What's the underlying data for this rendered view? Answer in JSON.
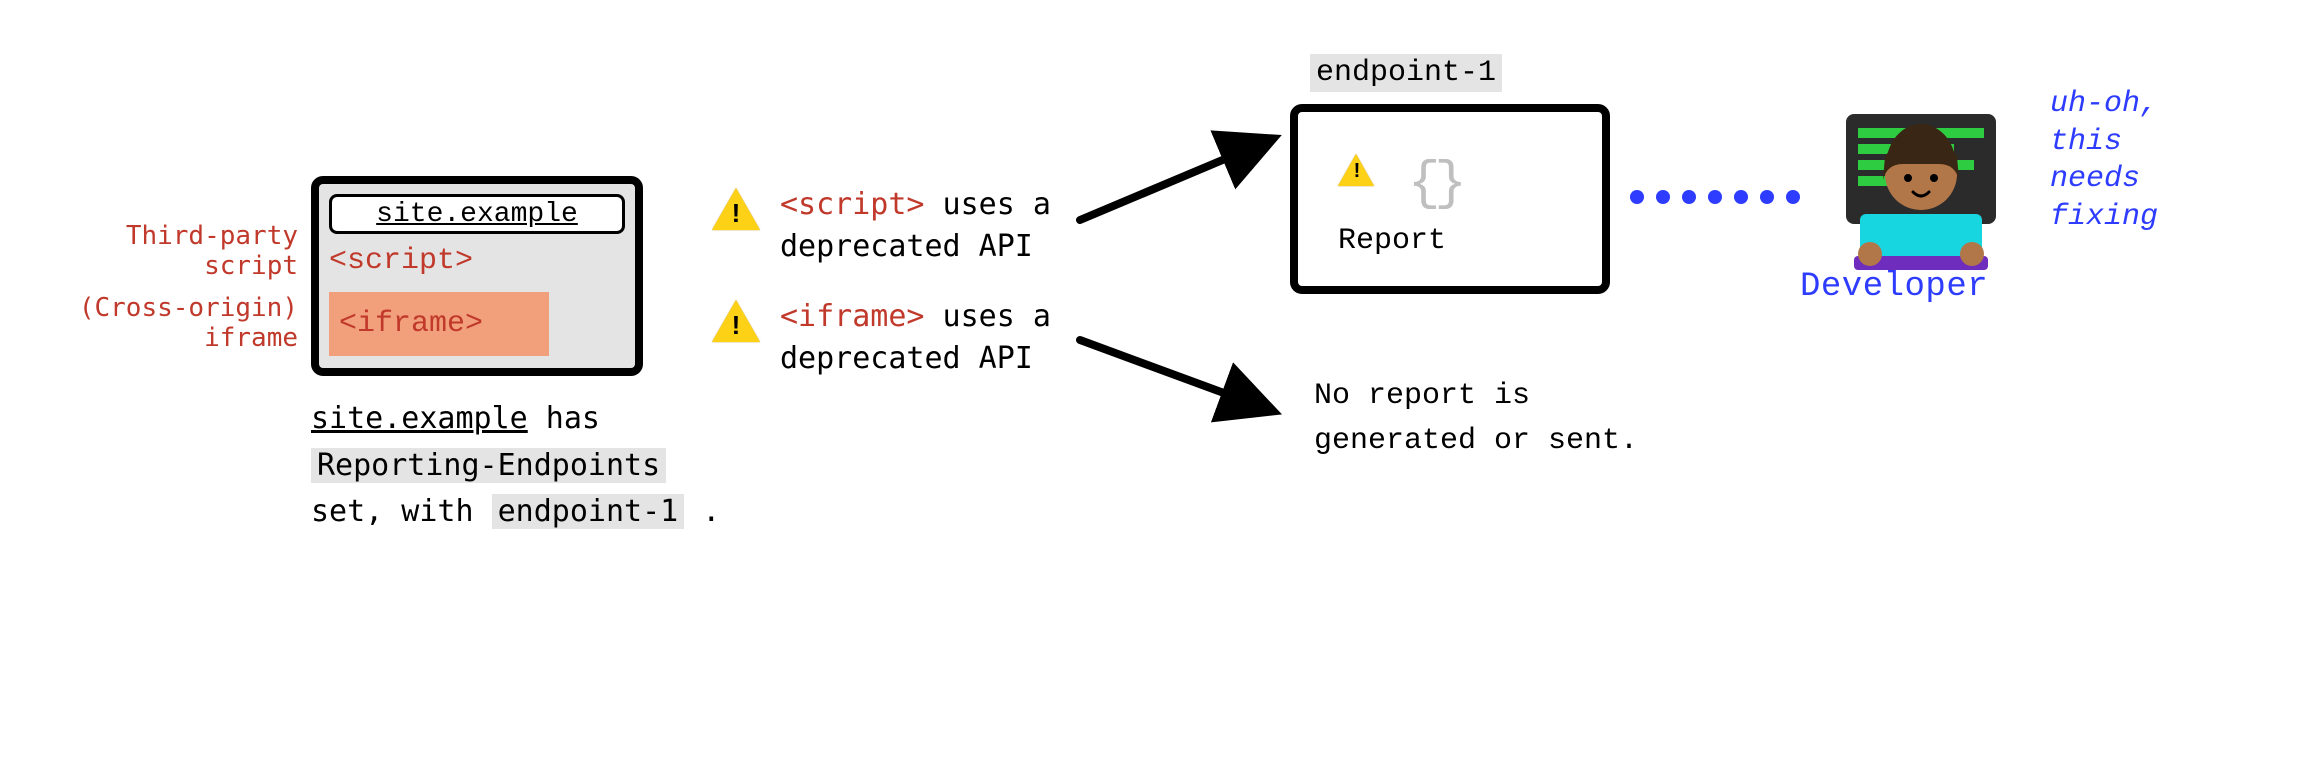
{
  "left_labels": {
    "third_party_script_l1": "Third-party",
    "third_party_script_l2": "script",
    "cross_origin_iframe_l1": "(Cross-origin)",
    "cross_origin_iframe_l2": "iframe"
  },
  "browser": {
    "url": "site.example",
    "script_tag": "<script>",
    "iframe_tag": "<iframe>"
  },
  "browser_caption": {
    "site": "site.example",
    "text_has": " has",
    "header": "Reporting-Endpoints",
    "text_set_with": "set, with ",
    "endpoint": "endpoint-1",
    "text_period": " ."
  },
  "messages": {
    "msg1_code": "<script>",
    "msg1_rest_l1": " uses a",
    "msg1_l2": "deprecated API",
    "msg2_code": "<iframe>",
    "msg2_rest_l1": " uses a",
    "msg2_l2": "deprecated API"
  },
  "endpoint": {
    "label": "endpoint-1",
    "braces": "{}",
    "report_text": "Report"
  },
  "no_report": {
    "l1": "No report is",
    "l2": "generated or sent."
  },
  "developer": {
    "label": "Developer",
    "thought_l1": "uh-oh,",
    "thought_l2": "this",
    "thought_l3": "needs",
    "thought_l4": "fixing"
  },
  "icons": {
    "warning": "warning",
    "report_braces": "code-braces"
  },
  "colors": {
    "accent_red": "#c0392b",
    "accent_blue": "#2d3cff",
    "warn_yellow": "#fcd116",
    "iframe_fill": "#f2a07b",
    "grey_hl": "#e4e4e4"
  }
}
